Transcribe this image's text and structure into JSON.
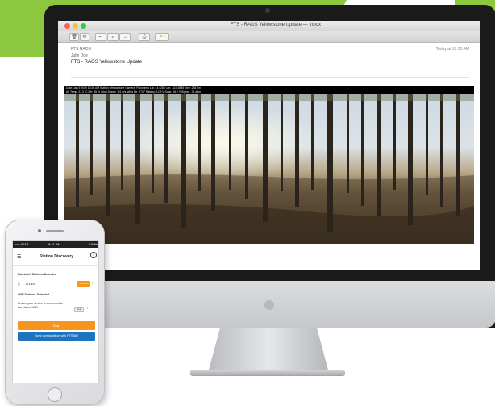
{
  "colors": {
    "accent_green": "#8dc63f",
    "app_orange": "#f7941d",
    "app_blue": "#1e73be"
  },
  "mail_window": {
    "title": "FTS - RAOS Yellowstone Update — Inbox",
    "toolbar_icons": [
      "trash-icon",
      "junk-icon",
      "reply-icon",
      "reply-all-icon",
      "forward-icon",
      "print-icon",
      "flag-icon"
    ],
    "from": "FTS RAOS",
    "to": "Julie Doe",
    "subject": "FTS - RAOS Yellowstone Update",
    "date": "Today at 10:30 AM",
    "overlay_line_1": "Date: Jan 5 2019 10:30 AM   Station: Yellowstone   Camera: Panorama   Lat: 44.4280   Lon: -110.5885   Elev: 2357 m",
    "overlay_line_2": "Air Temp: 21.3 °C   RH: 48 %   Wind Speed: 3.4 m/s   Wind Dir: 270 °   Battery: 12.9 V   Solar: 18.2 V   Signal: -71 dBm"
  },
  "phone_app": {
    "status_carrier": "•••• AT&T",
    "status_time": "9:41 PM",
    "status_battery": "100%",
    "title": "Station Discovery",
    "bluetooth_heading": "Bluetooth Stations Detected",
    "station_id": "G1304",
    "connect_label": "Connect",
    "wifi_heading": "WiFi Stations Detected",
    "hint": "Ensure your device is connected to the station WiFi.",
    "help_label": "Help",
    "scan_label": "Scan",
    "sync_label": "Sync configuration with FTS360"
  }
}
